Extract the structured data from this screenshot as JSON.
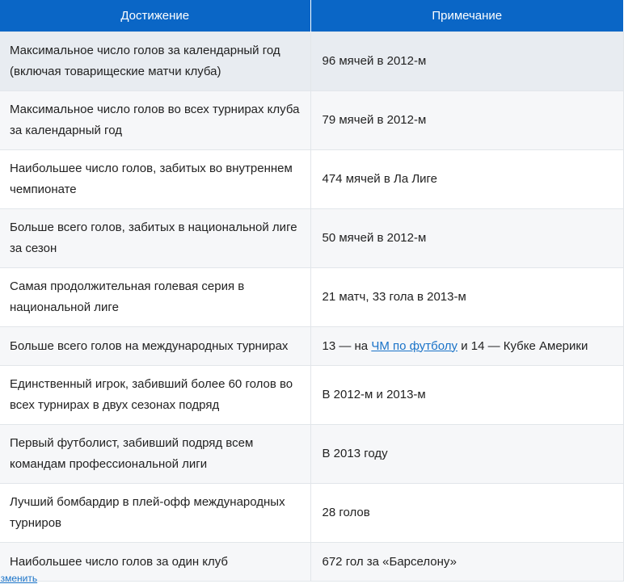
{
  "table": {
    "headers": [
      "Достижение",
      "Примечание"
    ],
    "rows": [
      {
        "achievement": "Максимальное число голов за календарный год (включая товарищеские матчи клуба)",
        "note": "96 мячей в 2012-м"
      },
      {
        "achievement": "Максимальное число голов во всех турнирах клуба за календарный год",
        "note": "79 мячей в 2012-м"
      },
      {
        "achievement": "Наибольшее число голов, забитых во внутреннем чемпионате",
        "note": "474 мячей в Ла Лиге"
      },
      {
        "achievement": "Больше всего голов, забитых в национальной лиге за сезон",
        "note": "50 мячей в 2012-м"
      },
      {
        "achievement": "Самая продолжительная голевая серия в национальной лиге",
        "note": "21 матч, 33 гола в 2013-м"
      },
      {
        "achievement": "Больше всего голов на международных турнирах",
        "note_before": "13 — на ",
        "note_link": "ЧМ по футболу",
        "note_after": " и 14 — Кубке Америки"
      },
      {
        "achievement": "Единственный игрок, забивший более 60 голов во всех турнирах в двух сезонах подряд",
        "note": "В 2012-м и 2013-м"
      },
      {
        "achievement": "Первый футболист, забивший подряд всем командам профессиональной лиги",
        "note": "В 2013 году"
      },
      {
        "achievement": "Лучший бомбардир в плей-офф международных турниров",
        "note": "28 голов"
      },
      {
        "achievement": "Наибольшее число голов за один клуб",
        "note": "672 гол за «Барселону»"
      }
    ]
  },
  "footer": {
    "edit_link": "Изменить"
  },
  "colors": {
    "header_bg": "#0a66c6",
    "link": "#1a73c8"
  }
}
